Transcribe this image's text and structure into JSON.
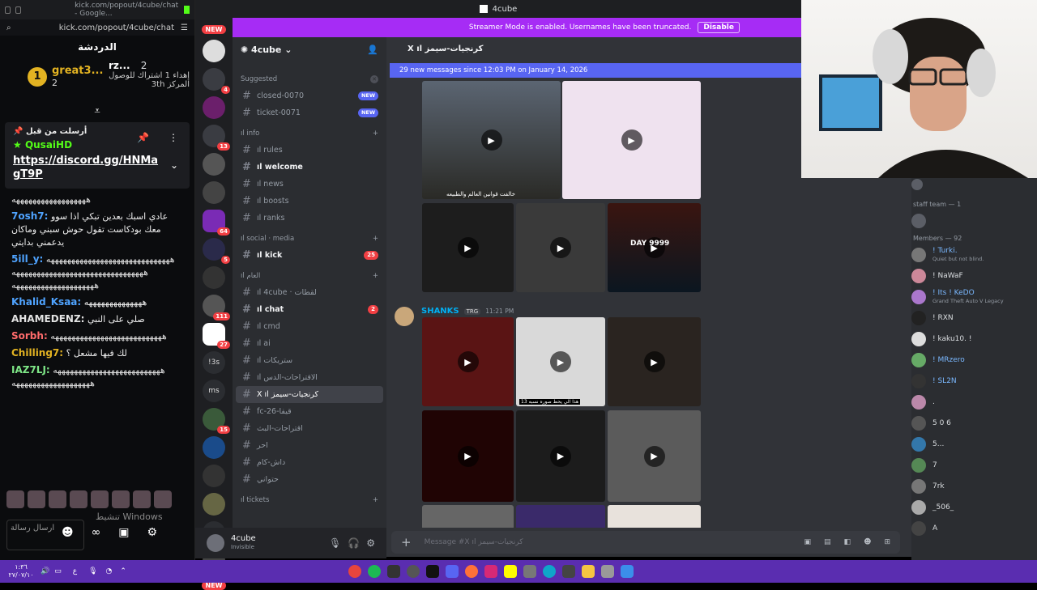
{
  "kick": {
    "tab_title": "kick.com/popout/4cube/chat - Google...",
    "url": "kick.com/popout/4cube/chat",
    "chat_title": "الدردشة",
    "leader1": {
      "rank": "1",
      "name": "great3...",
      "count": "2"
    },
    "leader2": {
      "name": "rz...",
      "count": "2",
      "text": "إهداء 1 اشتراك للوصول المركز 3th"
    },
    "pinned_header": "أرسلت من قبل",
    "pinned_user": "QusaiHD",
    "pinned_link": "https://discord.gg/HNMagT9P",
    "messages": [
      {
        "name": "",
        "text": "ههههههههههههههههههه"
      },
      {
        "name": "7osh7:",
        "text": "عادي اسبك بعدين تبكي اذا سوو معك بودكاست تقول حوش سبني وماكان يدعمني بدايتي"
      },
      {
        "name": "5ill_y:",
        "text": "ههههههههههههههههههههههههههههههه ههههههههههههههههههههههههههههههههه ههههههههههههههههههههه"
      },
      {
        "name": "Khalid_Ksaa:",
        "text": "ههههههههههههههه"
      },
      {
        "name": "AHAMEDENZ:",
        "text": "صلي على النبي"
      },
      {
        "name": "Sorbh:",
        "text": "هههههههههههههههههههههههههههه"
      },
      {
        "name": "Chilling7:",
        "text": "لك فيها مشعل ؟"
      },
      {
        "name": "IAZ7LJ:",
        "text": "ههههههههههههههههههههههههههه هههههههههههههههههههه"
      }
    ],
    "input_placeholder": "ارسال رسالة",
    "watermark": "تنشيط Windows"
  },
  "topbar": {
    "server": "4cube"
  },
  "streamer": {
    "text": "Streamer Mode is enabled. Usernames have been truncated.",
    "button": "Disable"
  },
  "guilds": {
    "new_top": "NEW",
    "new_bottom": "NEW",
    "badges": [
      "4",
      "13",
      "64",
      "5",
      "111",
      "27",
      "15"
    ],
    "labels": [
      "!3s",
      "ms",
      "خشم"
    ]
  },
  "channels": {
    "server_name": "4cube",
    "suggested_label": "Suggested",
    "suggested": [
      {
        "name": "closed-0070",
        "badge": "NEW"
      },
      {
        "name": "ticket-0071",
        "badge": "NEW"
      }
    ],
    "cat_info": "ıl info",
    "info_channels": [
      {
        "name": "ıl rules"
      },
      {
        "name": "ıl welcome",
        "unread": true
      },
      {
        "name": "ıl news"
      },
      {
        "name": "ıl boosts"
      },
      {
        "name": "ıl ranks"
      }
    ],
    "cat_social": "ıl social · media",
    "social_channels": [
      {
        "name": "ıl kick",
        "badge": "25",
        "unread": true
      }
    ],
    "cat_general": "ıl العام",
    "general_channels": [
      {
        "name": "ıl 4cube · لقطات"
      },
      {
        "name": "ıl chat",
        "badge": "2",
        "unread": true
      },
      {
        "name": "ıl cmd"
      },
      {
        "name": "ıl ai"
      },
      {
        "name": "ıl ستريكات"
      },
      {
        "name": "ıl الاقتراحات-الدس"
      },
      {
        "name": "X ıl كرنجيات-سيمز",
        "active": true
      },
      {
        "name": "fc-26-قيفا"
      },
      {
        "name": "اقتراحات-البث"
      },
      {
        "name": "احر"
      },
      {
        "name": "داش-كام"
      },
      {
        "name": "حتواني"
      }
    ],
    "cat_tickets": "ıl tickets"
  },
  "user": {
    "name": "4cube",
    "status": "Invisible"
  },
  "main": {
    "channel_title": "X ıl كرنجيات-سيمز",
    "new_messages": "29 new messages since 12:03 PM on January 14, 2026",
    "author": "SHANKS",
    "author_tag": "TRG",
    "time": "11:21 PM",
    "composer_placeholder": "Message #X ıl كرنجيات-سيمز",
    "captions": [
      "خالفت قوانين العالم والطبيعه",
      "هذا الي يحط صوره نسبه 13",
      "DAY 9999"
    ]
  },
  "members": {
    "staff_label": "staff team — 1",
    "members_label": "Members — 92",
    "list": [
      {
        "name": "! Turki. ",
        "status": "Quiet but not blind."
      },
      {
        "name": "! NaWaF",
        "status": ""
      },
      {
        "name": "! Its ! KeDO",
        "status": "Grand Theft Auto V Legacy"
      },
      {
        "name": "! RXN",
        "status": ""
      },
      {
        "name": "! kaku10. !",
        "status": ""
      },
      {
        "name": "! MRzero",
        "status": ""
      },
      {
        "name": "! SL2N",
        "status": ""
      },
      {
        "name": ".",
        "status": ""
      },
      {
        "name": "5 0 6",
        "status": ""
      },
      {
        "name": "5...",
        "status": ""
      },
      {
        "name": "7",
        "status": ""
      },
      {
        "name": "7rk",
        "status": ""
      },
      {
        "name": "_506_",
        "status": ""
      },
      {
        "name": "A",
        "status": ""
      }
    ]
  },
  "taskbar": {
    "time": "١:٣٦",
    "date": "٢٧/٠٧/١٠",
    "lang": "ع"
  }
}
